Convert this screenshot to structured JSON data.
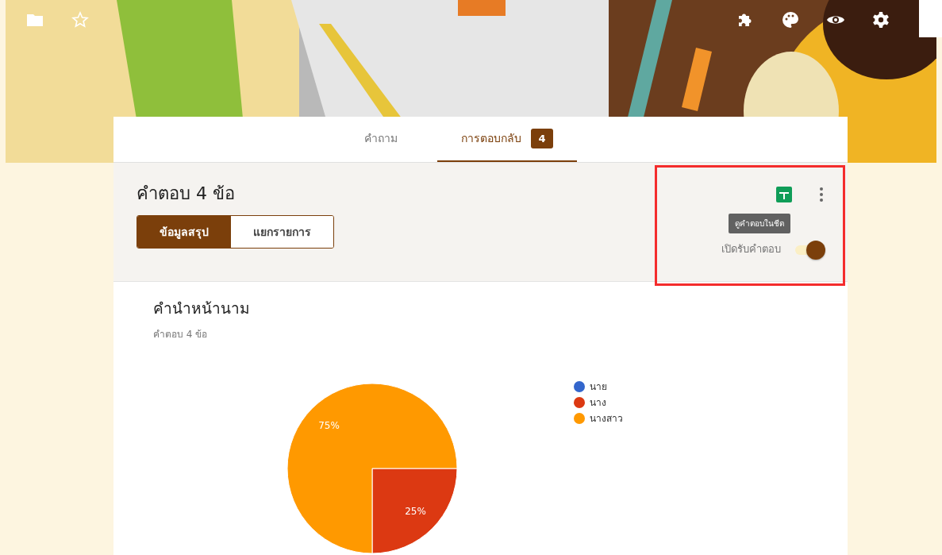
{
  "tabs": [
    {
      "label": "คำถาม",
      "selected": false
    },
    {
      "label": "การตอบกลับ",
      "selected": true,
      "badge": "4"
    }
  ],
  "summary": {
    "title": "คำตอบ 4 ข้อ",
    "views": [
      {
        "label": "ข้อมูลสรุป",
        "selected": true
      },
      {
        "label": "แยกรายการ",
        "selected": false
      }
    ],
    "tooltip": "ดูคำตอบในชีต",
    "accepting_label": "เปิดรับคำตอบ",
    "accepting": true
  },
  "question": {
    "title": "คำนำหน้านาม",
    "count": "คำตอบ 4 ข้อ",
    "chart_data": {
      "type": "pie",
      "categories": [
        "นาย",
        "นาง",
        "นางสาว"
      ],
      "values": [
        0,
        25,
        75
      ],
      "legend": "right",
      "colors": [
        "#3366cc",
        "#dc3912",
        "#ff9900"
      ],
      "value_labels": [
        null,
        "25%",
        "75%"
      ]
    }
  }
}
